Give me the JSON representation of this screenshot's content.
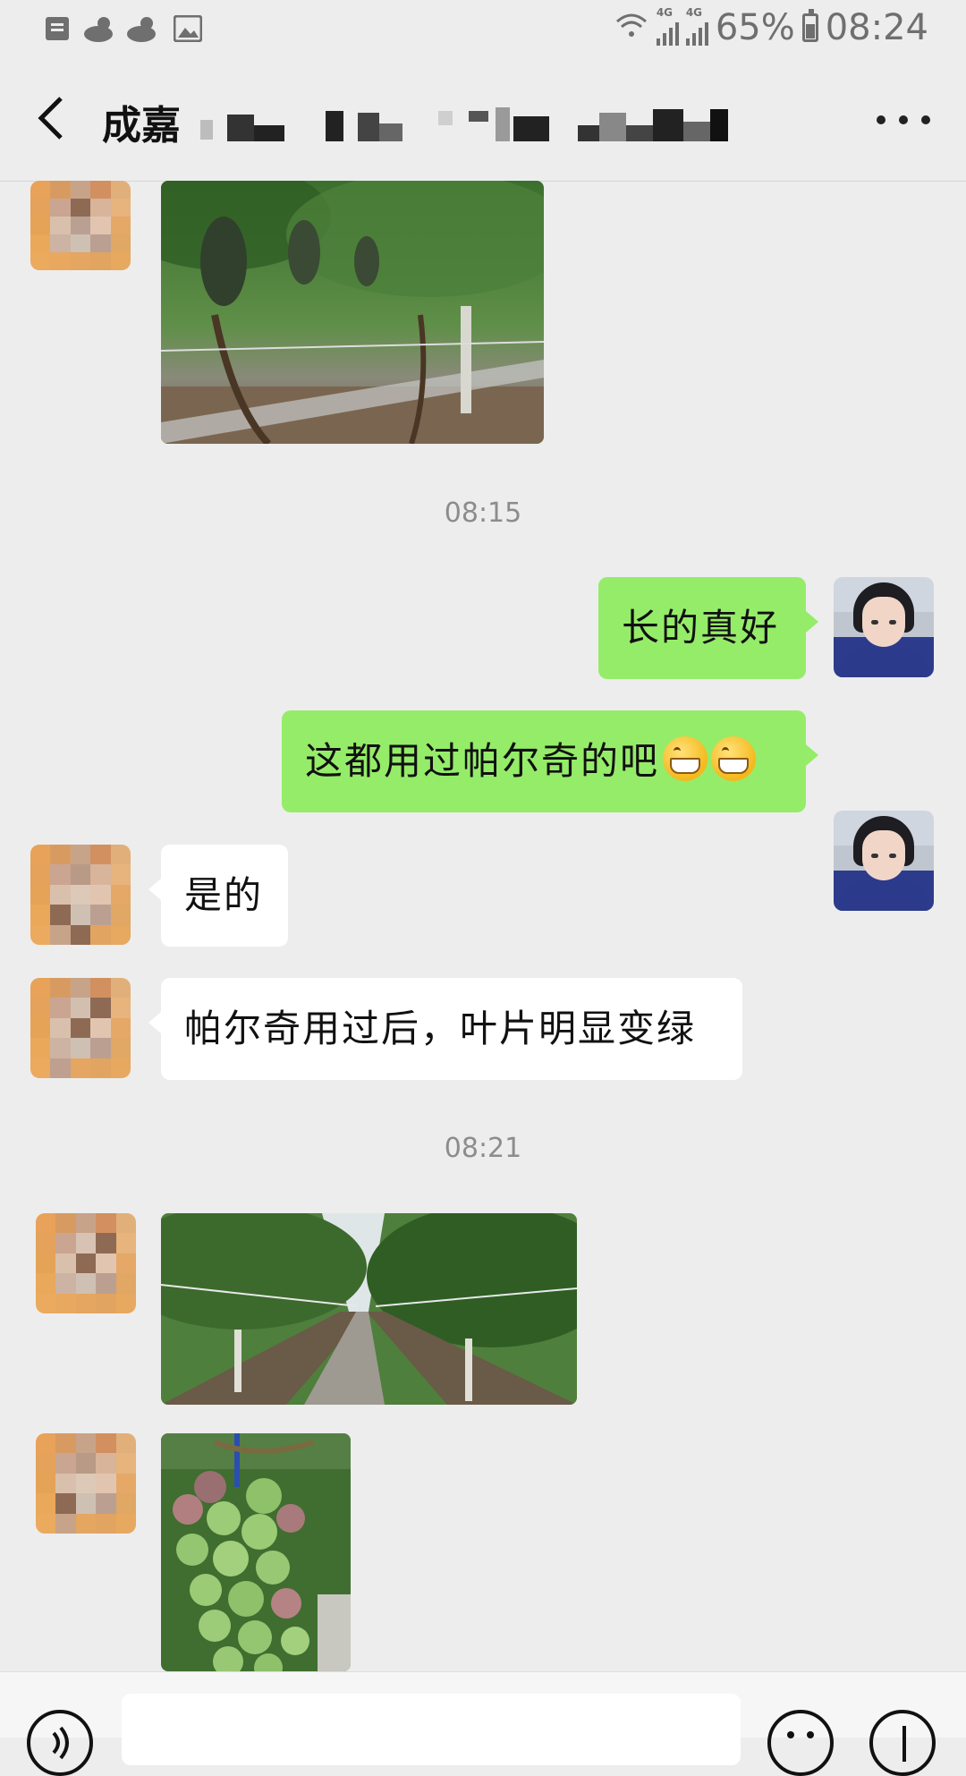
{
  "status_bar": {
    "battery": "65%",
    "time": "08:24",
    "network_1": "4G",
    "network_2": "4G",
    "icons": [
      "notification-icon",
      "weather-cloudy-sun-icon",
      "weather-cloudy-sun-icon",
      "gallery-icon",
      "wifi-icon",
      "signal-icon",
      "signal-icon",
      "battery-icon"
    ]
  },
  "nav": {
    "title": "成嘉",
    "back_icon": "chevron-left-icon",
    "more_icon": "more-dots-icon"
  },
  "timestamps": {
    "t1": "08:15",
    "t2": "08:21"
  },
  "messages": [
    {
      "from": "me",
      "text": "长的真好"
    },
    {
      "from": "me",
      "text": "这都用过帕尔奇的吧",
      "emoji_count": 2,
      "emoji": "grinning-face-icon"
    },
    {
      "from": "other",
      "text": "是的"
    },
    {
      "from": "other",
      "text": "帕尔奇用过后，叶片明显变绿"
    }
  ],
  "bottom_bar": {
    "voice_icon": "voice-icon",
    "emoji_icon": "smile-icon",
    "plus_icon": "plus-icon"
  }
}
